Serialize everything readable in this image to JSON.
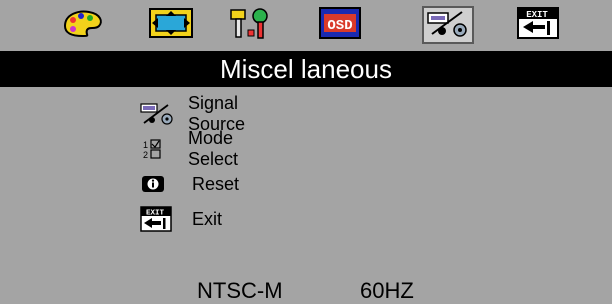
{
  "toolbar": {
    "tabs": [
      {
        "icon": "palette-icon"
      },
      {
        "icon": "position-arrows-icon"
      },
      {
        "icon": "tools-icon"
      },
      {
        "icon": "osd-icon",
        "label": "OSD"
      },
      {
        "icon": "signal-source-icon",
        "active": true
      },
      {
        "icon": "exit-icon",
        "label": "EXIT"
      }
    ]
  },
  "title": "Miscel laneous",
  "menu": {
    "items": [
      {
        "label": "Signal Source",
        "icon": "signal-source-icon"
      },
      {
        "label": "Mode Select",
        "icon": "mode-select-icon"
      },
      {
        "label": "Reset",
        "icon": "info-icon"
      },
      {
        "label": "Exit",
        "icon": "exit-icon"
      }
    ]
  },
  "status": {
    "standard": "NTSC-M",
    "frequency": "60HZ"
  },
  "colors": {
    "background": "#a4a4a4",
    "title_bar": "#000000",
    "title_text": "#ffffff"
  }
}
